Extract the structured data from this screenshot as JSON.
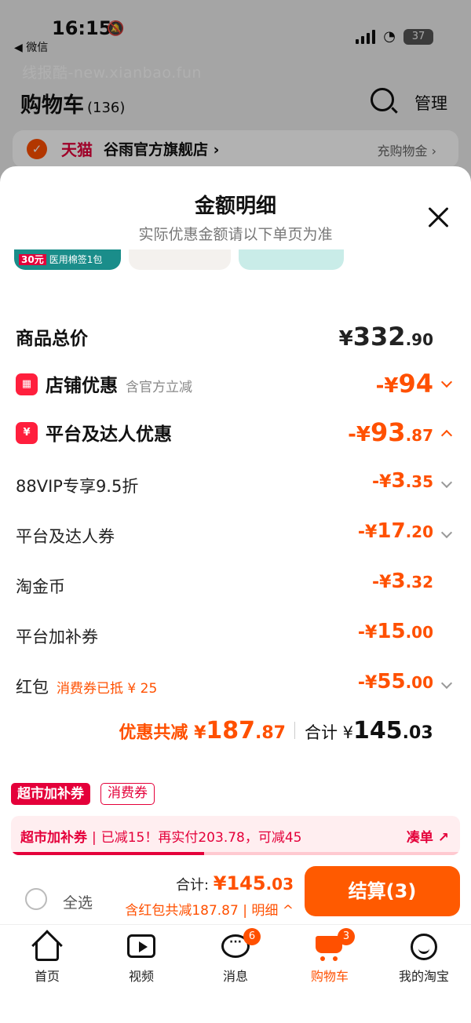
{
  "status_bar": {
    "time": "16:15",
    "back_app": "◀ 微信",
    "battery": "37"
  },
  "watermark": "线报酷-new.xianbao.fun",
  "cart_header": {
    "title": "购物车",
    "count": "(136)",
    "manage": "管理"
  },
  "store": {
    "platform": "天猫",
    "name": "谷雨官方旗舰店 ›",
    "recharge": "充购物金 ›"
  },
  "sheet": {
    "title": "金额明细",
    "subtitle": "实际优惠金额请以下单页为准",
    "peek_badge": "30元",
    "peek_text": "医用棉签1包"
  },
  "lines": {
    "total_price": {
      "label": "商品总价",
      "sign": "¥",
      "int": "332",
      "dec": ".90"
    },
    "store_discount": {
      "label": "店铺优惠",
      "note": "含官方立减",
      "sign": "-¥",
      "int": "94",
      "dec": ""
    },
    "platform_discount": {
      "label": "平台及达人优惠",
      "sign": "-¥",
      "int": "93",
      "dec": ".87"
    },
    "vip": {
      "label": "88VIP专享9.5折",
      "sign": "-¥",
      "int": "3",
      "dec": ".35"
    },
    "coupon": {
      "label": "平台及达人券",
      "sign": "-¥",
      "int": "17",
      "dec": ".20"
    },
    "coin": {
      "label": "淘金币",
      "sign": "-¥",
      "int": "3",
      "dec": ".32"
    },
    "subsidy": {
      "label": "平台加补券",
      "sign": "-¥",
      "int": "15",
      "dec": ".00"
    },
    "red_packet": {
      "label": "红包",
      "note": "消费券已抵 ¥ 25",
      "sign": "-¥",
      "int": "55",
      "dec": ".00"
    }
  },
  "summary": {
    "save_label": "优惠共减 ¥",
    "save_int": "187",
    "save_dec": ".87",
    "total_label": "合计 ¥",
    "total_int": "145",
    "total_dec": ".03"
  },
  "tags": {
    "supermarket": "超市加补券",
    "consumption": "消费券"
  },
  "promo_bar": {
    "title": "超市加补券",
    "message": "已减15！再实付203.78，可减45",
    "link": "凑单 ↗",
    "progress": 0.43
  },
  "checkout": {
    "select_all": "全选",
    "sum_label": "合计: ",
    "sum_currency": "¥",
    "sum_int": "145",
    "sum_dec": ".03",
    "detail": "含红包共减187.87 | 明细 ^",
    "pay_button": "结算(3)"
  },
  "tabs": [
    {
      "label": "首页",
      "icon": "home-icon"
    },
    {
      "label": "视频",
      "icon": "video-icon"
    },
    {
      "label": "消息",
      "icon": "message-icon",
      "badge": "6"
    },
    {
      "label": "购物车",
      "icon": "cart-icon",
      "badge": "3",
      "active": true
    },
    {
      "label": "我的淘宝",
      "icon": "profile-icon"
    }
  ],
  "colors": {
    "accent": "#ff5000",
    "tmall_red": "#e4003a"
  }
}
